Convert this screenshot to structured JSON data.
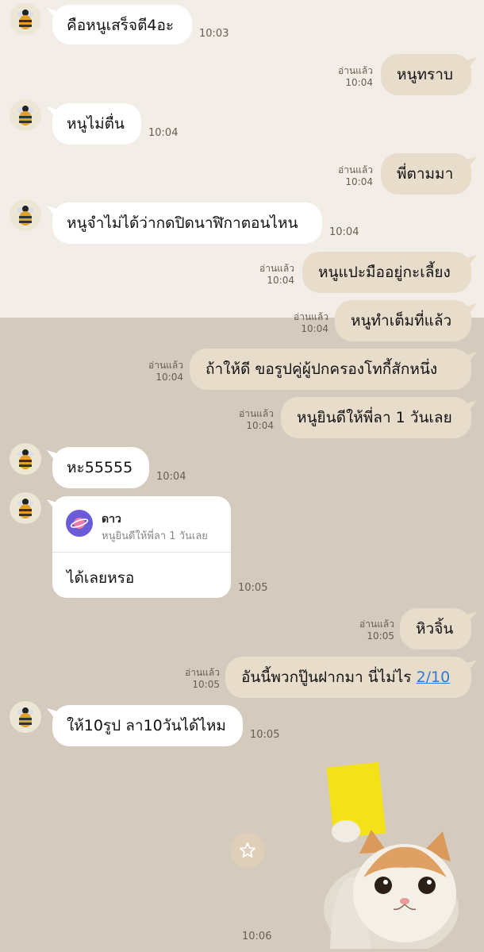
{
  "colors": {
    "top_background": "#f2ede6",
    "bottom_background": "#d4cbbe",
    "incoming_bubble": "#ffffff",
    "outgoing_bubble": "#e8dccb",
    "meta_text": "#6b5d4f",
    "link": "#2b7bd8"
  },
  "read_label": "อ่านแล้ว",
  "messages": [
    {
      "dir": "in",
      "text": "คือหนูเสร็จตี4อะ",
      "time": "10:03",
      "avatar_icon": "bee-icon"
    },
    {
      "dir": "out",
      "text": "หนูทราบ",
      "time": "10:04"
    },
    {
      "dir": "in",
      "text": "หนูไม่ตื่น",
      "time": "10:04",
      "avatar_icon": "bee-icon"
    },
    {
      "dir": "out",
      "text": "พี่ตามมา",
      "time": "10:04"
    },
    {
      "dir": "in",
      "text": "หนูจำไม่ได้ว่ากดปิดนาฬิกาตอนไหน",
      "time": "10:04",
      "avatar_icon": "bee-icon"
    },
    {
      "dir": "out",
      "text": "หนูแปะมืออยู่กะเลี้ยง",
      "time": "10:04"
    },
    {
      "dir": "out",
      "text": "หนูทำเต็มที่แล้ว",
      "time": "10:04"
    },
    {
      "dir": "out",
      "text": "ถ้าให้ดี ขอรูปคู่ผู้ปกครองโทกี้สักหนึ่ง",
      "time": "10:04"
    },
    {
      "dir": "out",
      "text": "หนูยินดีให้พี่ลา 1 วันเลย",
      "time": "10:04"
    },
    {
      "dir": "in",
      "text": "หะ55555",
      "time": "10:04",
      "avatar_icon": "bee-icon"
    },
    {
      "dir": "in",
      "type": "reply",
      "quote_name": "ดาว",
      "quote_text": "หนูยินดีให้พี่ลา 1 วันเลย",
      "quote_avatar_icon": "planet-icon",
      "text": "ได้เลยหรอ",
      "time": "10:05",
      "avatar_icon": "bee-icon"
    },
    {
      "dir": "out",
      "text": "หิวจิ้น",
      "time": "10:05"
    },
    {
      "dir": "out",
      "text": "อันนี้พวกปู๊นฝากมา นี่ไม่ไร",
      "link": "2/10",
      "time": "10:05"
    },
    {
      "dir": "in",
      "text": "ให้10รูป ลา10วันได้ไหม",
      "time": "10:05",
      "avatar_icon": "bee-icon"
    },
    {
      "dir": "out",
      "type": "sticker",
      "sticker": "cat-holding-yellow-card-sticker",
      "time": "10:06"
    }
  ],
  "star_icon": "star-icon"
}
